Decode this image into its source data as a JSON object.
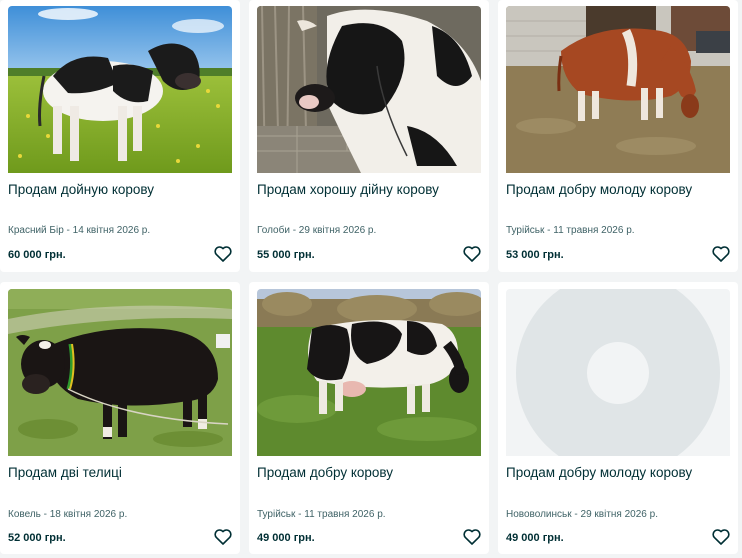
{
  "listings": [
    {
      "title": "Продам дойную корову",
      "meta": "Красний Бір - 14 квітня 2026 р.",
      "price": "60 000 грн.",
      "photo": "cow-black-white-field-photo"
    },
    {
      "title": "Продам хорошу дійну корову",
      "meta": "Голоби - 29 квітня 2026 р.",
      "price": "55 000 грн.",
      "photo": "cow-barn-closeup-photo"
    },
    {
      "title": "Продам добру молоду корову",
      "meta": "Турійськ - 11 травня 2026 р.",
      "price": "53 000 грн.",
      "photo": "cow-brown-white-yard-photo"
    },
    {
      "title": "Продам дві телиці",
      "meta": "Ковель - 18 квітня 2026 р.",
      "price": "52 000 грн.",
      "photo": "heifer-black-grass-photo"
    },
    {
      "title": "Продам добру корову",
      "meta": "Турійськ - 11 травня 2026 р.",
      "price": "49 000 грн.",
      "photo": "cow-black-white-meadow-photo"
    },
    {
      "title": "Продам добру молоду корову",
      "meta": "Нововолинськ - 29 квітня 2026 р.",
      "price": "49 000 грн.",
      "photo": "image-placeholder"
    }
  ],
  "icons": {
    "favorite": "heart-outline-icon"
  },
  "colors": {
    "text": "#002f34",
    "meta": "#406367",
    "background": "#f2f4f5",
    "card": "#ffffff",
    "placeholder": "#e6eaeb"
  }
}
